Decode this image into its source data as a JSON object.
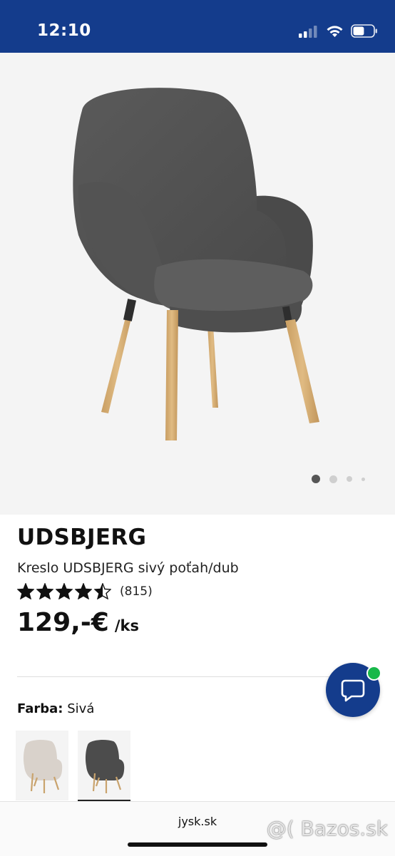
{
  "status_bar": {
    "time": "12:10",
    "battery_level": 0.55,
    "signal_bars_active": 2
  },
  "product": {
    "brand": "UDSBJERG",
    "name": "Kreslo UDSBJERG sivý poťah/dub",
    "rating": 4.5,
    "rating_count": "(815)",
    "price": "129,-€",
    "unit": "/ks"
  },
  "gallery": {
    "image_count": 4,
    "active_index": 0
  },
  "color": {
    "label": "Farba:",
    "value": "Sivá",
    "options": [
      {
        "name": "béžová",
        "color": "#d9d2cb"
      },
      {
        "name": "sivá",
        "color": "#4c4c4c",
        "selected": true
      }
    ]
  },
  "browser": {
    "url": "jysk.sk"
  },
  "watermark": "@( Bazos.sk",
  "colors": {
    "brand_blue": "#143c8c",
    "online_green": "#18b84a"
  }
}
